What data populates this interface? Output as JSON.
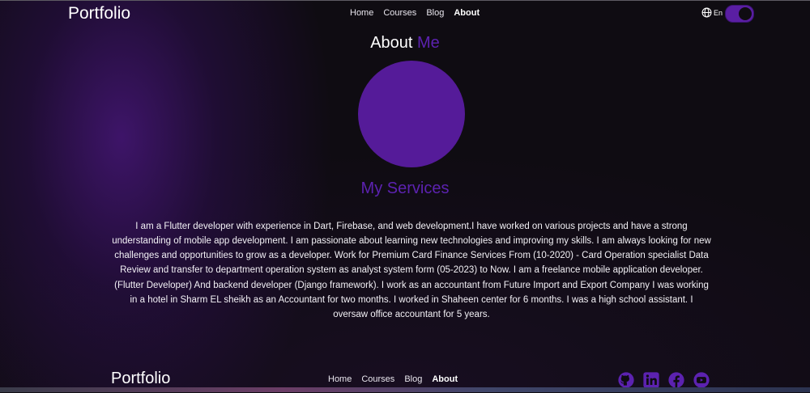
{
  "header": {
    "logo": "Portfolio",
    "nav": [
      "Home",
      "Courses",
      "Blog",
      "About"
    ],
    "active_nav": "About",
    "language": "En",
    "theme_toggle_on": true
  },
  "about": {
    "title_word1": "About",
    "title_word2": "Me",
    "services_title": "My Services",
    "bio": "I am a Flutter developer with experience in Dart, Firebase, and web development.I have worked on various projects and have a strong understanding of mobile app development. I am passionate about learning new technologies and improving my skills. I am always looking for new challenges and opportunities to grow as a developer. Work for Premium Card Finance Services From (10-2020) - Card Operation specialist Data Review and transfer to department operation system as analyst system form (05-2023) to Now. I am a freelance mobile application developer. (Flutter Developer) And backend developer (Django framework). I work as an accountant from Future Import and Export Company  I was working in a hotel in Sharm EL sheikh as an Accountant for two months.  I worked in Shaheen center for 6 months.  I was a high school assistant. I oversaw office accountant for 5 years."
  },
  "footer": {
    "logo": "Portfolio",
    "nav": [
      "Home",
      "Courses",
      "Blog",
      "About"
    ],
    "active_nav": "About",
    "social_icons": [
      "github-icon",
      "linkedin-icon",
      "facebook-icon",
      "youtube-icon"
    ]
  },
  "colors": {
    "accent": "#5c22b0",
    "avatar": "#551b99",
    "background": "#0f0c12",
    "glow": "#46167a"
  }
}
